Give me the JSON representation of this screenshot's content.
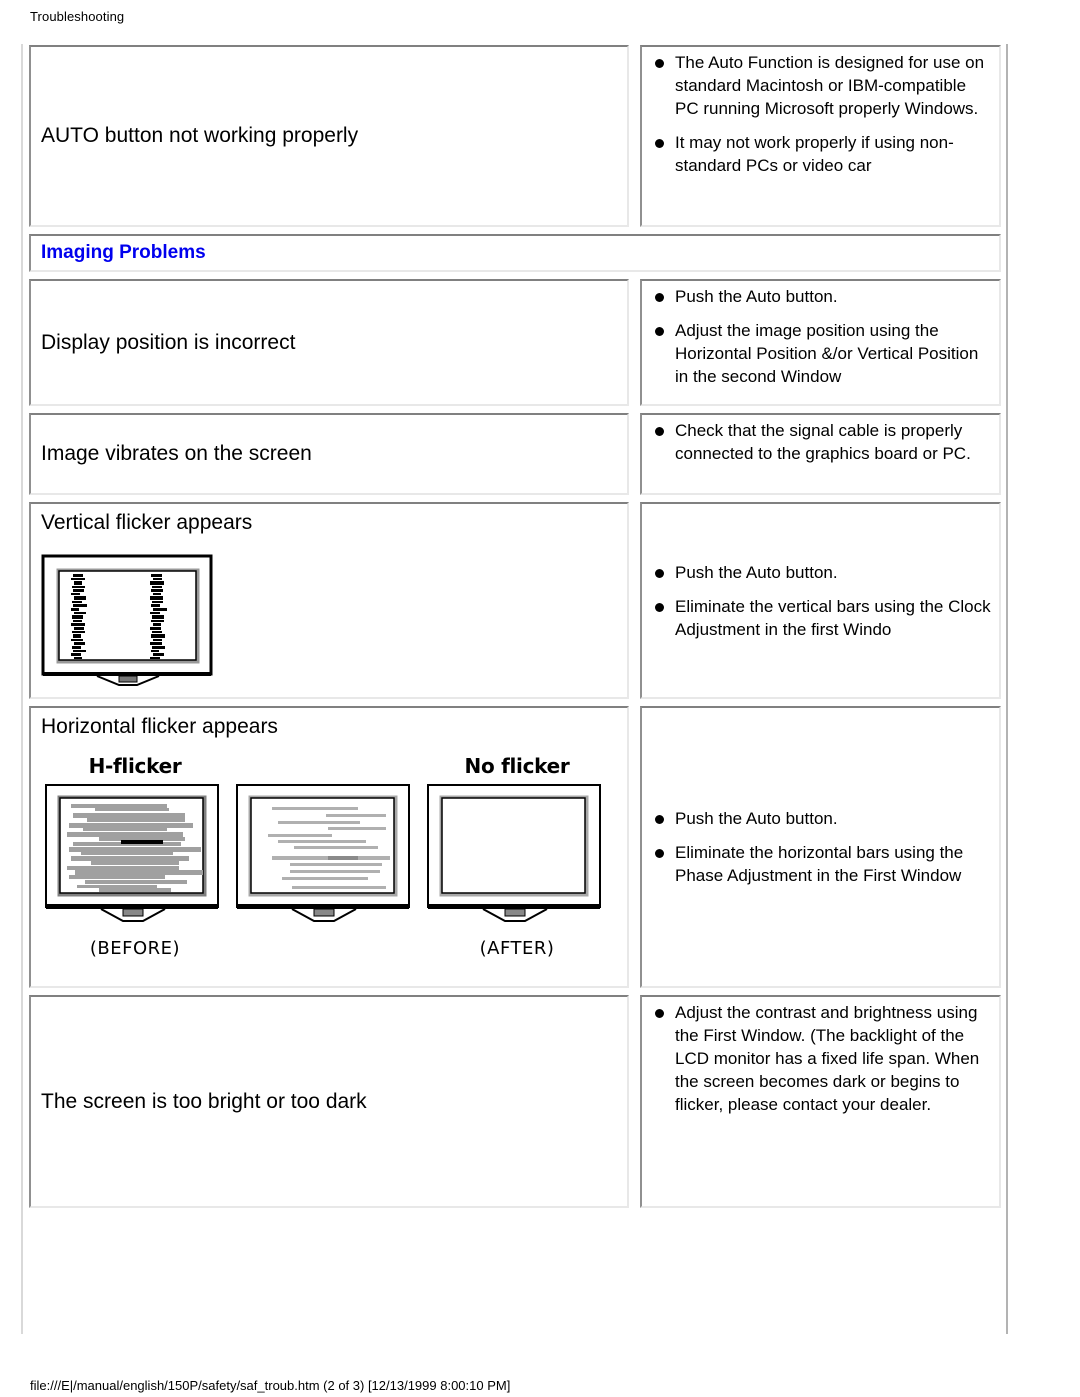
{
  "page": {
    "header_label": "Troubleshooting",
    "footer_text": "file:///E|/manual/english/150P/safety/saf_troub.htm (2 of 3) [12/13/1999 8:00:10 PM]"
  },
  "colors": {
    "section_title": "#0000ee",
    "text": "#000000",
    "cell_border_dark": "#808080",
    "cell_border_light": "#e8e8e8",
    "page_background": "#ffffff"
  },
  "table": {
    "rows": [
      {
        "id": "auto-button",
        "symptom": "AUTO button not working properly",
        "remedies": [
          "The Auto Function is designed for use on standard Macintosh or IBM-compatible PC running Microsoft properly Windows.",
          "It may not work properly if using non-standard PCs or video car"
        ]
      },
      {
        "id": "imaging-problems-heading",
        "section_title": "Imaging Problems"
      },
      {
        "id": "display-position",
        "symptom": "Display position is incorrect",
        "remedies": [
          "Push the Auto button.",
          "Adjust the image position using the Horizontal Position &/or Vertical Position in the second Window"
        ]
      },
      {
        "id": "image-vibrates",
        "symptom": "Image vibrates on the screen",
        "remedies": [
          "Check that the signal cable is properly connected to the graphics board or PC."
        ]
      },
      {
        "id": "vertical-flicker",
        "symptom": "Vertical flicker appears",
        "remedies": [
          "Push the Auto button.",
          "Eliminate the vertical bars using the Clock Adjustment in the first Windo"
        ],
        "figure": "vertical-flicker-monitor"
      },
      {
        "id": "horizontal-flicker",
        "symptom": "Horizontal flicker appears",
        "remedies": [
          "Push the Auto button.",
          "Eliminate the horizontal bars using the Phase Adjustment in the First Window"
        ],
        "figure": "horizontal-flicker-monitors",
        "figure_labels": {
          "left_top": "H-flicker",
          "left_bottom": "(BEFORE)",
          "right_top": "No flicker",
          "right_bottom": "(AFTER)"
        }
      },
      {
        "id": "screen-brightness",
        "symptom": "The screen is too bright or too dark",
        "remedies": [
          "Adjust the contrast and brightness using the First Window. (The backlight of the LCD monitor has a fixed life span. When the screen becomes dark or begins to flicker, please contact your dealer."
        ]
      }
    ]
  }
}
